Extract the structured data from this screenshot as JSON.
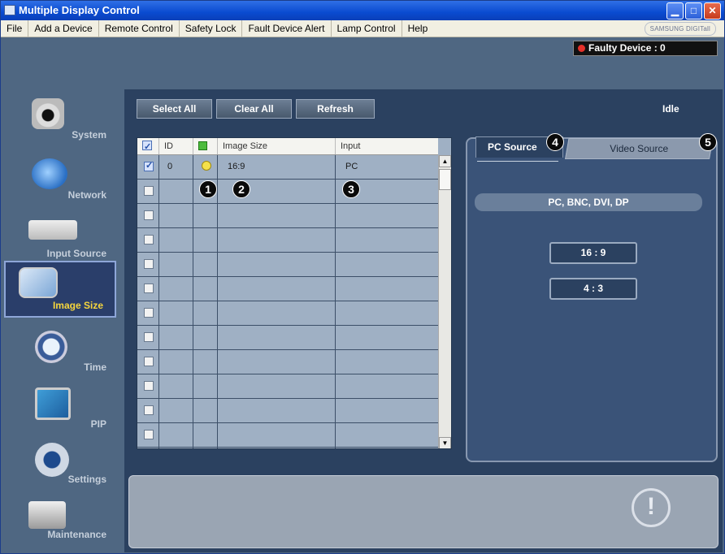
{
  "window": {
    "title": "Multiple Display Control"
  },
  "menu": [
    "File",
    "Add a Device",
    "Remote Control",
    "Safety Lock",
    "Fault Device Alert",
    "Lamp Control",
    "Help"
  ],
  "brand": "SAMSUNG DIGITall",
  "faulty": "Faulty Device : 0",
  "sidebar": [
    {
      "label": "System",
      "icon": "system-icon"
    },
    {
      "label": "Network",
      "icon": "network-icon"
    },
    {
      "label": "Input Source",
      "icon": "input-source-icon"
    },
    {
      "label": "Image Size",
      "icon": "image-size-icon",
      "selected": true
    },
    {
      "label": "Time",
      "icon": "time-icon"
    },
    {
      "label": "PIP",
      "icon": "pip-icon"
    },
    {
      "label": "Settings",
      "icon": "settings-icon"
    },
    {
      "label": "Maintenance",
      "icon": "maintenance-icon"
    }
  ],
  "toolbar": {
    "select_all": "Select All",
    "clear_all": "Clear All",
    "refresh": "Refresh"
  },
  "status": "Idle",
  "grid": {
    "headers": [
      "ID",
      "Image Size",
      "Input"
    ],
    "rows": [
      {
        "checked": true,
        "id": "0",
        "status": "on",
        "image_size": "16:9",
        "input": "PC"
      }
    ],
    "empty_rows": 12
  },
  "callouts": [
    "1",
    "2",
    "3",
    "4",
    "5"
  ],
  "tabs": {
    "pc": "PC Source",
    "video": "Video Source"
  },
  "source_list": "PC, BNC, DVI, DP",
  "sizes": [
    "16 : 9",
    "4 : 3"
  ],
  "warning": "!"
}
